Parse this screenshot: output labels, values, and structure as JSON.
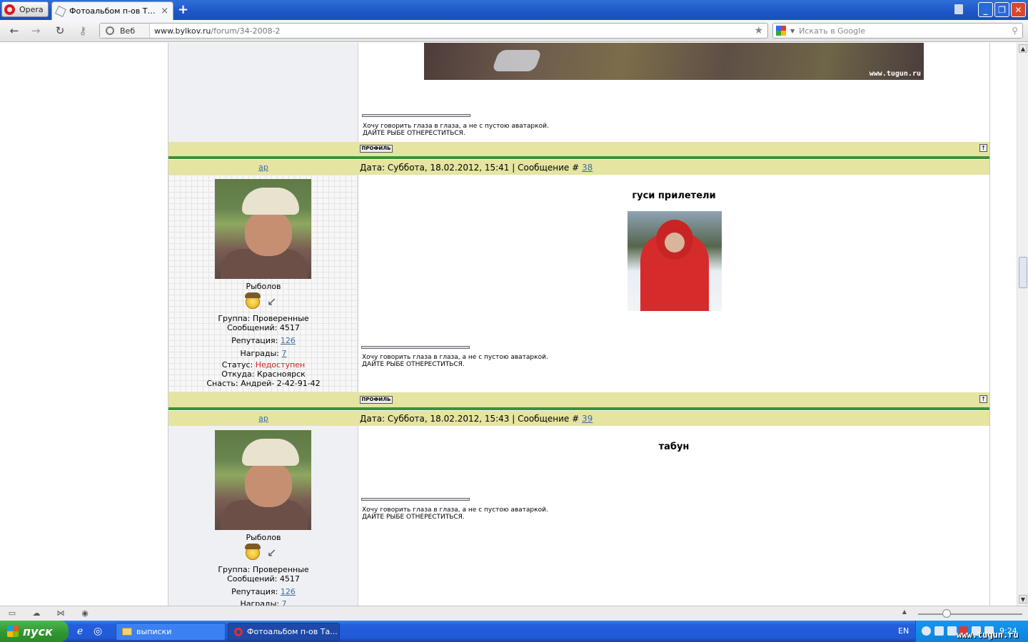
{
  "browser": {
    "menu_label": "Opera",
    "tab_title": "Фотоальбом п-ов Тайм...",
    "new_tab_glyph": "+",
    "close_glyph": "×",
    "win_min": "_",
    "win_max": "❐",
    "win_close": "✕"
  },
  "toolbar": {
    "context_label": "Веб",
    "url_host": "www.bylkov.ru",
    "url_path": "/forum/34-2008-2",
    "search_placeholder": "Искать в Google"
  },
  "forum": {
    "top_image_watermark": "www.tugun.ru",
    "signature_line1": "Хочу говорить глаза в глаза, а не с пустою аватаркой.",
    "signature_line2": "ДАЙТЕ РЫБЕ ОТНЕРЕСТИТЬСЯ.",
    "profile_button": "ПРОФИЛЬ",
    "top_button": "↑",
    "posts": [
      {
        "author": "ар",
        "date_prefix": "Дата: Суббота, 18.02.2012, 15:41 | Сообщение # ",
        "msg_num": "38",
        "rank": "Рыболов",
        "group": "Группа: Проверенные",
        "messages": "Сообщений: 4517",
        "rep_label": "Репутация: ",
        "rep_value": "126",
        "awards_label": "Награды: ",
        "awards_value": "7",
        "status_label": "Статус: ",
        "status_value": "Недоступен",
        "from": "Откуда: Красноярск",
        "gear": "Снасть: Андрей- 2-42-91-42",
        "title": "гуси прилетели"
      },
      {
        "author": "ар",
        "date_prefix": "Дата: Суббота, 18.02.2012, 15:43 | Сообщение # ",
        "msg_num": "39",
        "rank": "Рыболов",
        "group": "Группа: Проверенные",
        "messages": "Сообщений: 4517",
        "rep_label": "Репутация: ",
        "rep_value": "126",
        "awards_label": "Награды: ",
        "awards_value": "7",
        "title": "табун"
      }
    ]
  },
  "taskbar": {
    "start_label": "пуск",
    "task1": "выписки",
    "task2": "Фотоальбом п-ов Та...",
    "lang": "EN",
    "clock": "9:24",
    "watermark": "www.tugun.ru"
  },
  "colors": {
    "header_bar": "#e5e4a1",
    "separator": "#3f9131",
    "link": "#3a6fa8",
    "status_offline": "#cc2222"
  }
}
